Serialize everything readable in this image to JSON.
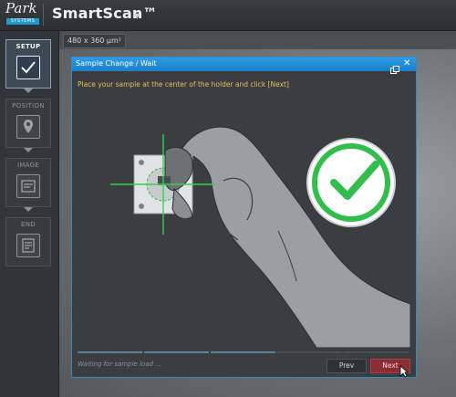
{
  "header": {
    "logo_text": "Park",
    "logo_subtext": "SYSTEMS",
    "app_title": "SmartScan™"
  },
  "workflow": {
    "steps": [
      {
        "label": "SETUP",
        "icon": "checkmark-icon",
        "active": true
      },
      {
        "label": "POSITION",
        "icon": "map-pin-icon",
        "active": false
      },
      {
        "label": "IMAGE",
        "icon": "image-icon",
        "active": false
      },
      {
        "label": "END",
        "icon": "report-icon",
        "active": false
      }
    ]
  },
  "viewer": {
    "scan_size": "480 x 360 μm²"
  },
  "dialog": {
    "title": "Sample Change  /  Wait",
    "instruction": "Place your sample at the center of the holder and click [Next]",
    "status": "Waiting for sample load ...",
    "prev_label": "Prev",
    "next_label": "Next",
    "progress_segments": 5
  },
  "colors": {
    "accent": "#1f8fd6",
    "instruction": "#e0c25e",
    "next_button": "#8c2c33",
    "check_green": "#2fbf4a"
  }
}
